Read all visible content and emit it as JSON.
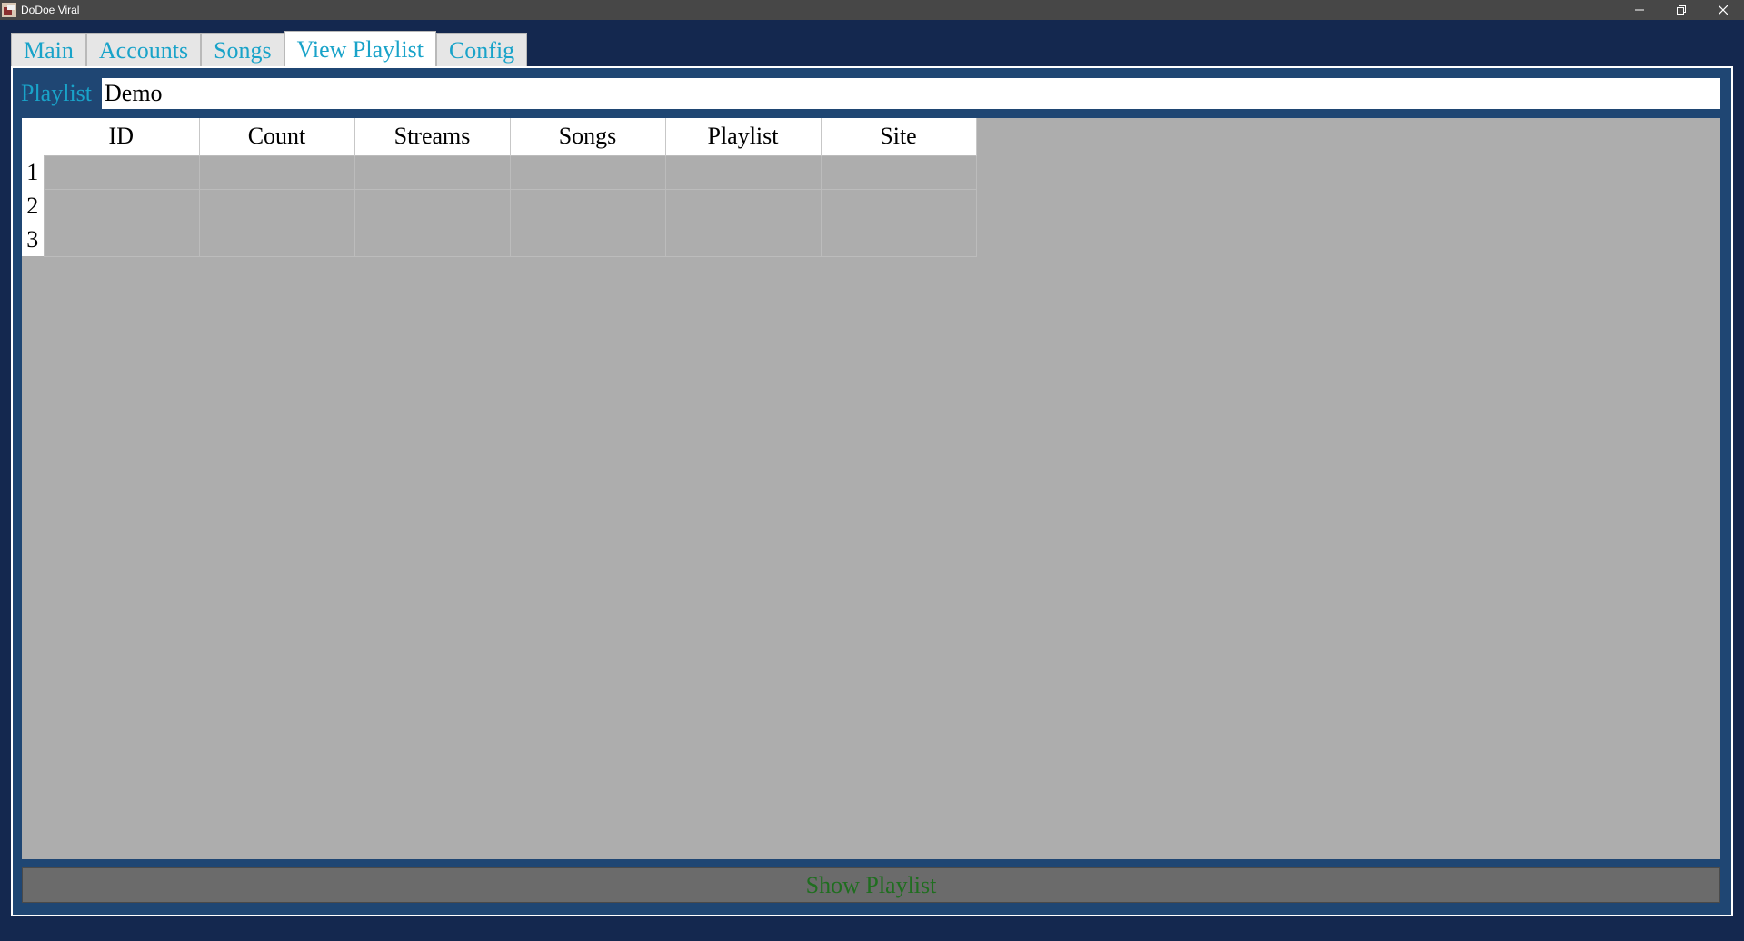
{
  "window": {
    "title": "DoDoe Viral",
    "icon": "app-icon",
    "controls": [
      "minimize-icon",
      "restore-icon",
      "close-icon"
    ]
  },
  "tabs": [
    {
      "label": "Main",
      "active": false
    },
    {
      "label": "Accounts",
      "active": false
    },
    {
      "label": "Songs",
      "active": false
    },
    {
      "label": "View Playlist",
      "active": true
    },
    {
      "label": "Config",
      "active": false
    }
  ],
  "playlist": {
    "label": "Playlist",
    "value": "Demo"
  },
  "table": {
    "columns": [
      "ID",
      "Count",
      "Streams",
      "Songs",
      "Playlist",
      "Site"
    ],
    "row_numbers": [
      "1",
      "2",
      "3"
    ]
  },
  "actions": {
    "show_playlist": "Show Playlist"
  },
  "colors": {
    "background": "#14284f",
    "panel": "#1f4673",
    "tab_text": "#19a3c9",
    "grid_bg": "#adadad",
    "button_bg": "#6b6b6b",
    "button_text": "#1f6e1f"
  }
}
